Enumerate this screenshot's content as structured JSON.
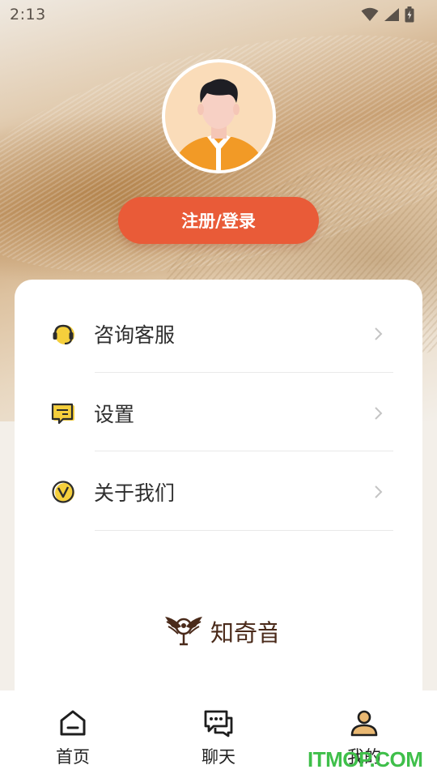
{
  "status_bar": {
    "time": "2:13",
    "icons": [
      "wifi-icon",
      "signal-icon",
      "battery-icon"
    ]
  },
  "profile": {
    "avatar": "default-avatar",
    "login_label": "注册/登录"
  },
  "menu": {
    "items": [
      {
        "label": "咨询客服",
        "icon": "headset-icon"
      },
      {
        "label": "设置",
        "icon": "settings-icon"
      },
      {
        "label": "关于我们",
        "icon": "about-icon"
      }
    ]
  },
  "brand": {
    "logo": "zhiqiyin-logo",
    "text": "知奇音"
  },
  "tabbar": {
    "tabs": [
      {
        "label": "首页",
        "icon": "home-icon"
      },
      {
        "label": "聊天",
        "icon": "chat-icon"
      },
      {
        "label": "我的",
        "icon": "profile-icon",
        "active": true
      }
    ]
  },
  "watermark": "ITMOP.COM",
  "colors": {
    "accent": "#e95b38",
    "icon_yellow": "#f5cf3c",
    "brand_brown": "#4a2a1a",
    "watermark_green": "#3fbf4a"
  }
}
